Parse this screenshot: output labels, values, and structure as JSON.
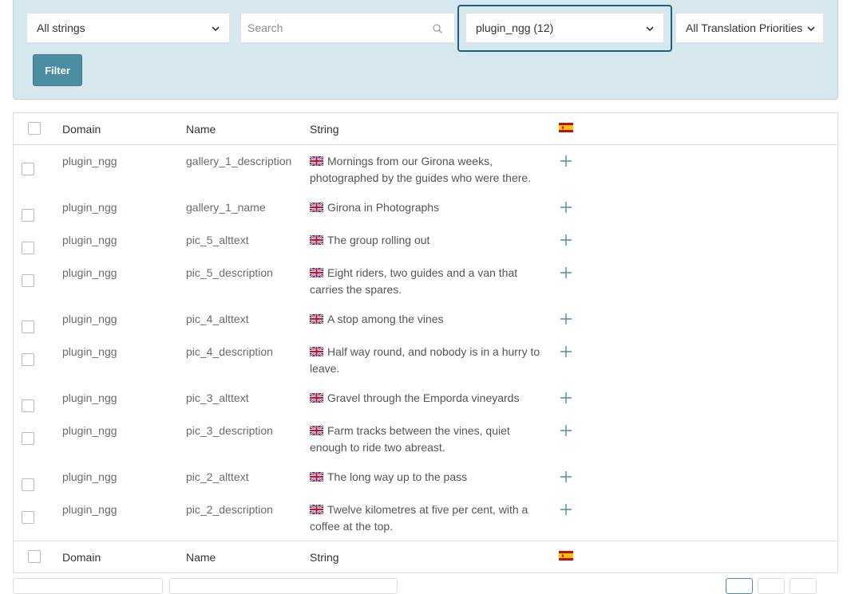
{
  "filters": {
    "strings_select": "All strings",
    "search_placeholder": "Search",
    "domain_select": "plugin_ngg (12)",
    "priority_select": "All Translation Priorities",
    "filter_button": "Filter"
  },
  "table": {
    "columns": {
      "domain": "Domain",
      "name": "Name",
      "string": "String"
    },
    "rows": [
      {
        "domain": "plugin_ngg",
        "name": "gallery_1_description",
        "string": "Mornings from our Girona weeks, photographed by the guides who were there."
      },
      {
        "domain": "plugin_ngg",
        "name": "gallery_1_name",
        "string": "Girona in Photographs"
      },
      {
        "domain": "plugin_ngg",
        "name": "pic_5_alttext",
        "string": "The group rolling out"
      },
      {
        "domain": "plugin_ngg",
        "name": "pic_5_description",
        "string": "Eight riders, two guides and a van that carries the spares."
      },
      {
        "domain": "plugin_ngg",
        "name": "pic_4_alttext",
        "string": "A stop among the vines"
      },
      {
        "domain": "plugin_ngg",
        "name": "pic_4_description",
        "string": "Half way round, and nobody is in a hurry to leave."
      },
      {
        "domain": "plugin_ngg",
        "name": "pic_3_alttext",
        "string": "Gravel through the Emporda vineyards"
      },
      {
        "domain": "plugin_ngg",
        "name": "pic_3_description",
        "string": "Farm tracks between the vines, quiet enough to ride two abreast."
      },
      {
        "domain": "plugin_ngg",
        "name": "pic_2_alttext",
        "string": "The long way up to the pass"
      },
      {
        "domain": "plugin_ngg",
        "name": "pic_2_description",
        "string": "Twelve kilometres at five per cent, with a coffee at the top."
      }
    ]
  },
  "icons": {
    "language_column": "spain-flag-icon",
    "source_language": "uk-flag-icon",
    "add_translation": "plus-icon"
  },
  "colors": {
    "filter_panel": "#d6e7ed",
    "accent": "#4d8da4",
    "focus_outline": "#1f5f80"
  }
}
